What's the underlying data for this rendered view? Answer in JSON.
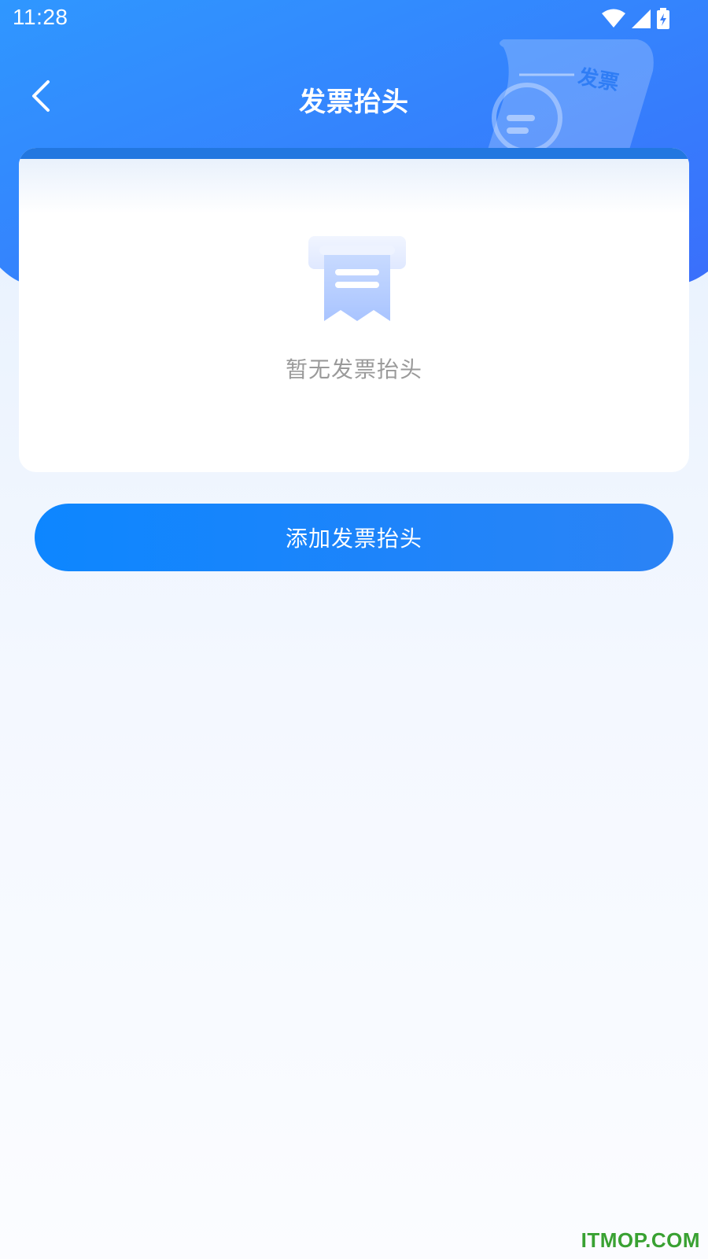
{
  "status_bar": {
    "time": "11:28",
    "icons": [
      "wifi-icon",
      "signal-icon",
      "battery-charging-icon"
    ]
  },
  "header": {
    "title": "发票抬头",
    "back_icon": "chevron-left-icon",
    "decoration_text": "发票"
  },
  "empty_state": {
    "icon": "receipt-icon",
    "message": "暂无发票抬头"
  },
  "actions": {
    "add_label": "添加发票抬头"
  },
  "watermark": "ITMOP.COM",
  "colors": {
    "header_start": "#2f97ff",
    "header_end": "#3a6ffb",
    "button": "#0d86ff",
    "card_topbar": "#2277e0",
    "empty_text": "#9a9a9a",
    "watermark": "#39a132"
  }
}
